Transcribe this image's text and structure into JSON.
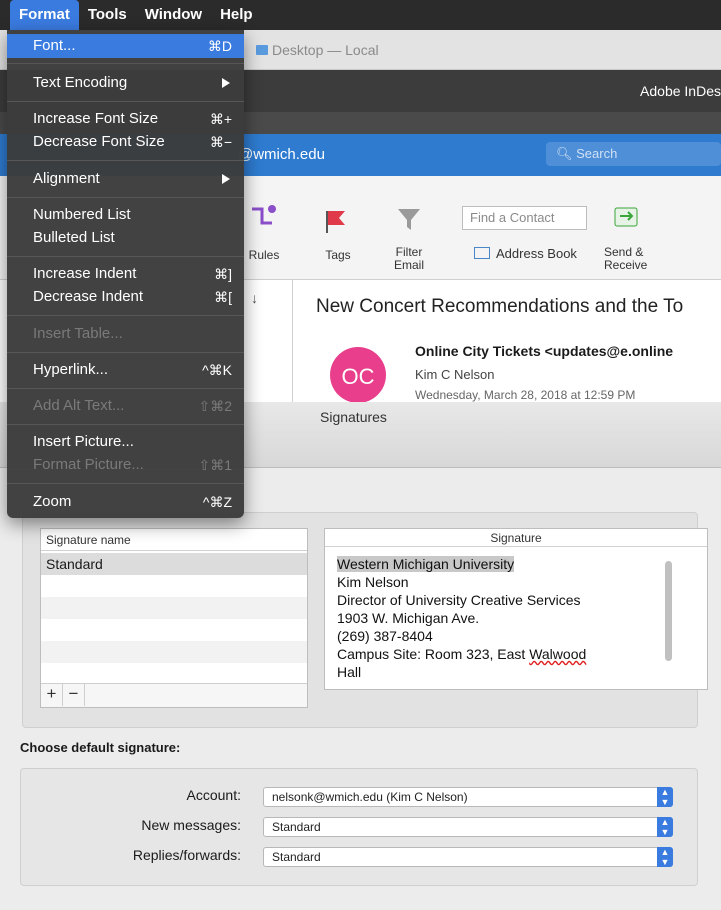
{
  "menubar": {
    "items": [
      "Format",
      "Tools",
      "Window",
      "Help"
    ]
  },
  "format_menu": {
    "font": "Font...",
    "font_sc": "⌘D",
    "text_encoding": "Text Encoding",
    "increase_font": "Increase Font Size",
    "increase_font_sc": "⌘+",
    "decrease_font": "Decrease Font Size",
    "decrease_font_sc": "⌘−",
    "alignment": "Alignment",
    "numbered_list": "Numbered List",
    "bulleted_list": "Bulleted List",
    "increase_indent": "Increase Indent",
    "increase_indent_sc": "⌘]",
    "decrease_indent": "Decrease Indent",
    "decrease_indent_sc": "⌘[",
    "insert_table": "Insert Table...",
    "hyperlink": "Hyperlink...",
    "hyperlink_sc": "^⌘K",
    "add_alt_text": "Add Alt Text...",
    "add_alt_text_sc": "⇧⌘2",
    "insert_picture": "Insert Picture...",
    "format_picture": "Format Picture...",
    "format_picture_sc": "⇧⌘1",
    "zoom": "Zoom",
    "zoom_sc": "^⌘Z"
  },
  "finder": {
    "title": "Desktop — Local"
  },
  "indesign": {
    "title": "Adobe InDes"
  },
  "outlook": {
    "account_email": "@wmich.edu",
    "search_placeholder": "Search",
    "ribbon": {
      "rules": "Rules",
      "tags": "Tags",
      "filter": "Filter",
      "filter2": "Email",
      "find_contact": "Find a Contact",
      "address_book": "Address Book",
      "send": "Send &",
      "send2": "Receive"
    },
    "message": {
      "subject": "New Concert Recommendations  and the To",
      "avatar_initials": "OC",
      "sender": "Online City Tickets <updates@e.online",
      "recipient": "Kim C Nelson",
      "datetime": "Wednesday, March 28, 2018 at 12:59 PM"
    }
  },
  "signatures": {
    "window_title": "Signatures",
    "name_column": "Signature name",
    "signature_column": "Signature",
    "names": [
      "Standard"
    ],
    "add_button": "+",
    "remove_button": "−",
    "text": {
      "line1": "Western Michigan University",
      "line2": "Kim Nelson",
      "line3": "Director of University Creative Services",
      "line4": "1903 W. Michigan Ave.",
      "line5": "(269) 387-8404",
      "line6a": "Campus Site: Room 323, East ",
      "line6b": "Walwood",
      "line7": "Hall"
    },
    "choose_default_label": "Choose default signature:",
    "account_label": "Account:",
    "account_value": "nelsonk@wmich.edu (Kim C Nelson)",
    "new_messages_label": "New messages:",
    "new_messages_value": "Standard",
    "replies_label": "Replies/forwards:",
    "replies_value": "Standard"
  }
}
